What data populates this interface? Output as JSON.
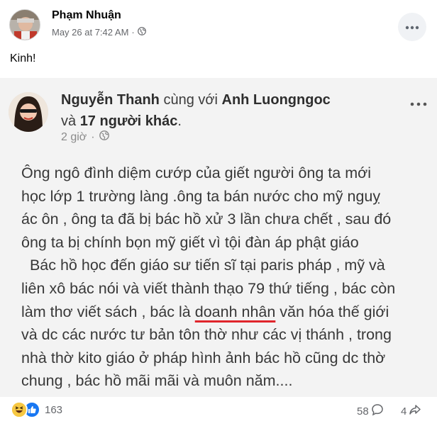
{
  "post": {
    "author": "Phạm Nhuận",
    "timestamp": "May 26 at 7:42 AM",
    "separator": "·",
    "privacy_icon": "globe-icon",
    "caption": "Kinh!"
  },
  "shared_image": {
    "author": "Nguyễn Thanh",
    "with_text": "cùng với",
    "tagged_user": "Anh Luongngoc",
    "and_text": "và",
    "others": "17 người khác",
    "period": ".",
    "time": "2 giờ",
    "separator": "·",
    "body_lines": [
      "Ông ngô đình diệm cướp của giết người ông ta mới",
      "học lớp 1 trường làng .ông ta bán nước cho mỹ nguỵ",
      "ác ôn , ông ta đã bị bác hồ xử 3 lần chưa chết , sau đó",
      "ông ta bị chính bọn mỹ giết vì tội đàn áp phật giáo",
      "  Bác hồ học đến giáo sư tiến sĩ tại paris pháp , mỹ và",
      "liên xô bác nói và viết thành thạo 79 thứ tiếng , bác còn"
    ],
    "line7_before": "làm thơ viết sách , bác là ",
    "line7_underlined": "doanh nhân",
    "line7_after": " văn hóa thế giới",
    "body_lines_end": [
      "và dc các nước tư bản tôn thờ như các vị thánh , trong",
      "nhà thờ kito giáo ở pháp hình ảnh bác hồ cũng dc thờ",
      "chung , bác hồ mãi mãi và muôn năm...."
    ]
  },
  "footer": {
    "reaction_count": "163",
    "comment_count": "58",
    "share_count": "4"
  },
  "colors": {
    "underline": "#e0252c",
    "like_blue": "#1877f2",
    "haha_yellow": "#f7c843"
  }
}
